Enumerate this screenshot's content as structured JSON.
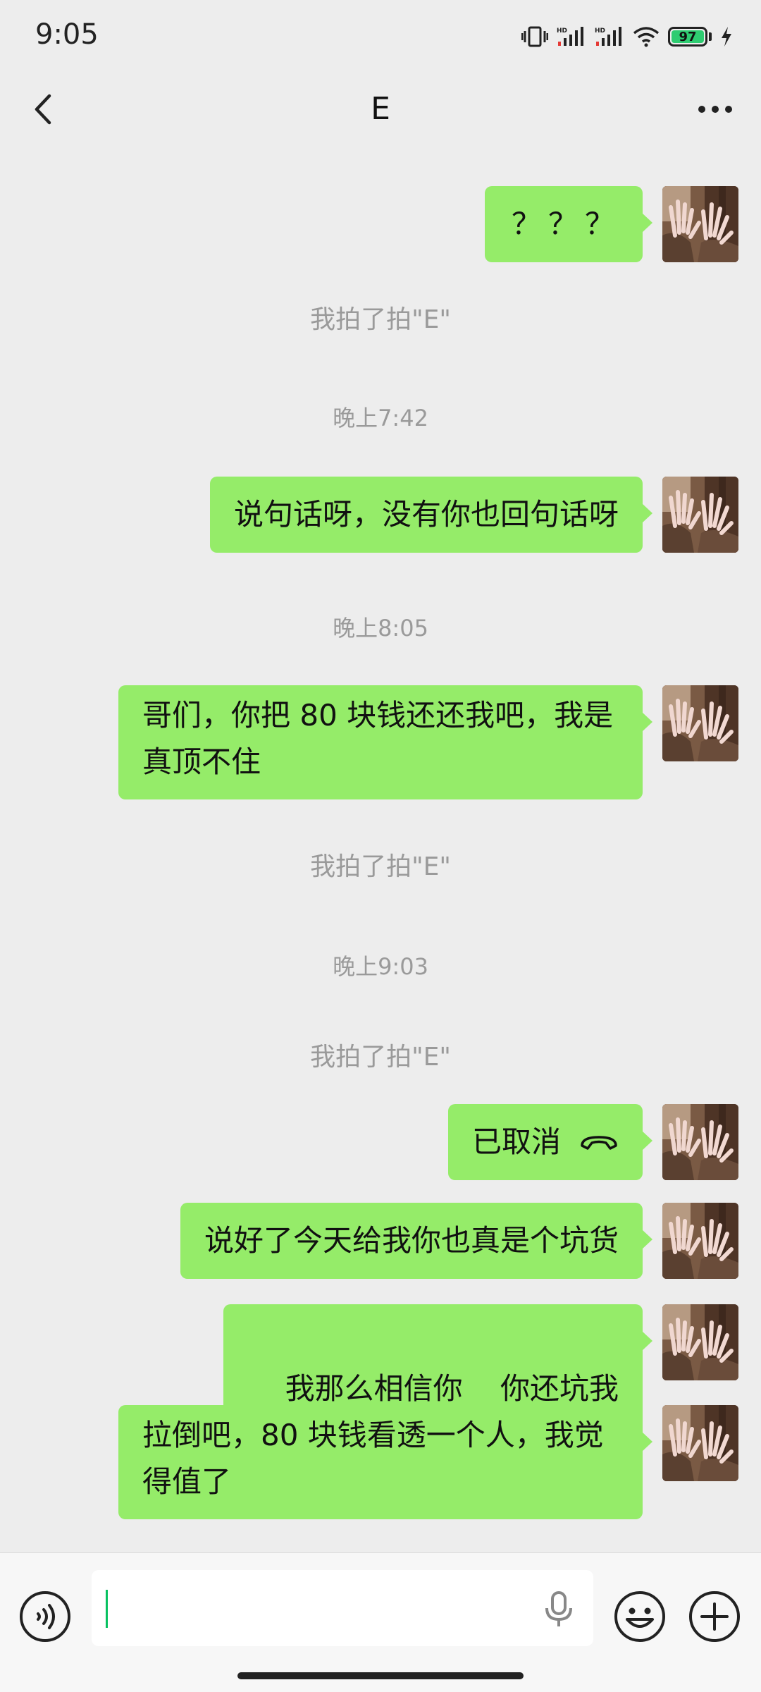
{
  "status_bar": {
    "time": "9:05",
    "battery_level": "97",
    "icons": [
      "vibrate-icon",
      "signal-hd-icon",
      "signal-hd-icon",
      "wifi-icon",
      "battery-icon",
      "charging-icon"
    ]
  },
  "header": {
    "title": "E",
    "back_icon": "chevron-left-icon",
    "more_icon": "more-dots-icon"
  },
  "messages": [
    {
      "type": "sent",
      "text": "？？？"
    },
    {
      "type": "system",
      "text": "我拍了拍\"E\""
    },
    {
      "type": "timestamp",
      "text": "晚上7:42"
    },
    {
      "type": "sent",
      "text": "说句话呀，没有你也回句话呀"
    },
    {
      "type": "timestamp",
      "text": "晚上8:05"
    },
    {
      "type": "sent",
      "text": "哥们，你把 80 块钱还还我吧，我是真顶不住"
    },
    {
      "type": "system",
      "text": "我拍了拍\"E\""
    },
    {
      "type": "timestamp",
      "text": "晚上9:03"
    },
    {
      "type": "system",
      "text": "我拍了拍\"E\""
    },
    {
      "type": "call",
      "text": "已取消",
      "icon": "hang-up-icon"
    },
    {
      "type": "sent",
      "text": "说好了今天给我你也真是个坑货"
    },
    {
      "type": "sent",
      "text": "我那么相信你    你还坑我"
    },
    {
      "type": "sent",
      "text": "拉倒吧，80 块钱看透一个人，我觉得值了"
    }
  ],
  "input_bar": {
    "voice_icon": "voice-icon",
    "mic_icon": "mic-icon",
    "emoji_icon": "emoji-icon",
    "plus_icon": "plus-icon",
    "text": ""
  },
  "colors": {
    "background": "#ededed",
    "sent_bubble": "#95ec69",
    "muted_text": "#9a9a9a",
    "cursor": "#07c160"
  }
}
